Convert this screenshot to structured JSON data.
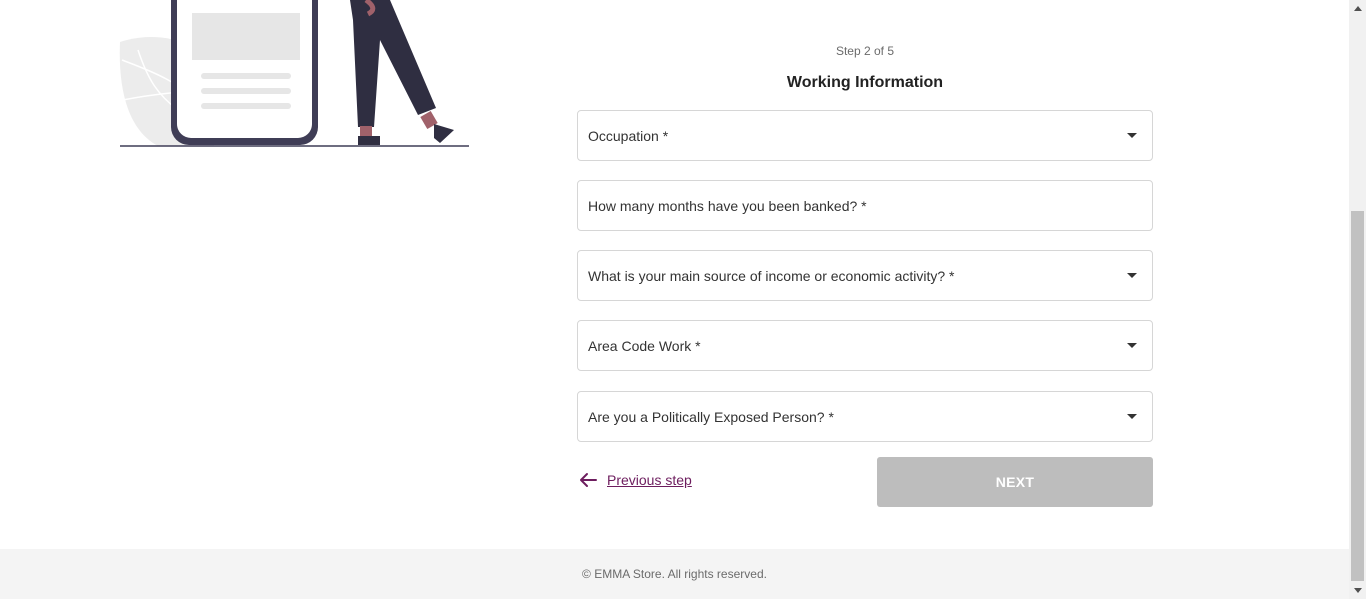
{
  "form": {
    "step_label": "Step 2 of 5",
    "title": "Working Information",
    "fields": [
      {
        "label": "Occupation *",
        "type": "select"
      },
      {
        "label": "How many months have you been banked? *",
        "type": "input"
      },
      {
        "label": "What is your main source of income or economic activity? *",
        "type": "select"
      },
      {
        "label": "Area Code Work *",
        "type": "select"
      },
      {
        "label": "Are you a Politically Exposed Person? *",
        "type": "select"
      }
    ],
    "previous_label": "Previous step",
    "next_label": "NEXT"
  },
  "footer": {
    "copyright": "© EMMA Store. All rights reserved."
  },
  "colors": {
    "accent": "#6d1d5e",
    "disabled_button": "#bdbdbd",
    "footer_bg": "#f4f4f4"
  },
  "icons": {
    "previous": "arrow-left-icon",
    "dropdown": "chevron-down-icon"
  }
}
